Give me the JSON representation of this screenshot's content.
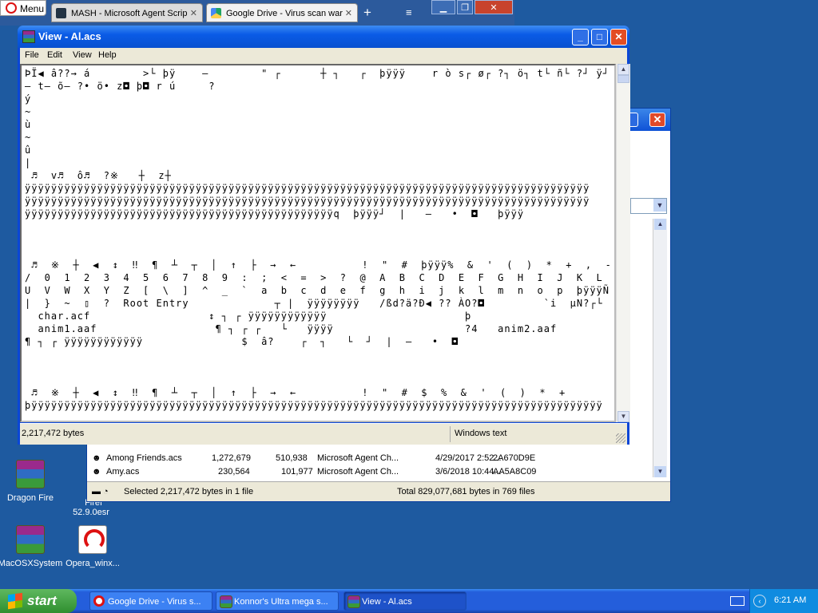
{
  "browser": {
    "menu_label": "Menu",
    "tabs": [
      {
        "title": "MASH - Microsoft Agent Scrip",
        "icon": "mash-favicon"
      },
      {
        "title": "Google Drive - Virus scan war",
        "icon": "google-drive-favicon"
      }
    ],
    "new_tab_glyph": "+",
    "menu_glyph": "≡"
  },
  "explorer": {
    "rows": [
      {
        "name": "Among Friends.acs",
        "size": "1,272,679",
        "packed": "510,938",
        "type": "Microsoft Agent Ch...",
        "modified": "4/29/2017 2:52...",
        "crc": "2A670D9E"
      },
      {
        "name": "Amy.acs",
        "size": "230,564",
        "packed": "101,977",
        "type": "Microsoft Agent Ch...",
        "modified": "3/6/2018 10:44...",
        "crc": "AA5A8C09"
      }
    ],
    "status_left": "Selected 2,217,472 bytes in 1 file",
    "status_right": "Total 829,077,681 bytes in 769 files"
  },
  "view": {
    "title": "View - Al.acs",
    "menu": [
      "File",
      "Edit",
      "View",
      "Help"
    ],
    "content": "ÞÏ◀ â??→ á        >└ þÿ    –        \" ┌      ┼ ┐   ┌  þÿÿÿ    r ò s┌ ø┌ ?┐ ö┐ t└ ñ└ ?┘ ÿ┘ y│\n– t– õ– ?• ö• z◘ þ◘ r ú     ?\ný\n~\nù\n~\nû\n|\n ♬  v♬  ô♬  ?※   ┼  z┼\nÿÿÿÿÿÿÿÿÿÿÿÿÿÿÿÿÿÿÿÿÿÿÿÿÿÿÿÿÿÿÿÿÿÿÿÿÿÿÿÿÿÿÿÿÿÿÿÿÿÿÿÿÿÿÿÿÿÿÿÿÿÿÿÿÿÿÿÿÿÿÿÿÿÿÿÿÿÿÿÿÿÿÿÿÿÿ\nÿÿÿÿÿÿÿÿÿÿÿÿÿÿÿÿÿÿÿÿÿÿÿÿÿÿÿÿÿÿÿÿÿÿÿÿÿÿÿÿÿÿÿÿÿÿÿÿÿÿÿÿÿÿÿÿÿÿÿÿÿÿÿÿÿÿÿÿÿÿÿÿÿÿÿÿÿÿÿÿÿÿÿÿÿÿ\nÿÿÿÿÿÿÿÿÿÿÿÿÿÿÿÿÿÿÿÿÿÿÿÿÿÿÿÿÿÿÿÿÿÿÿÿÿÿÿÿÿÿÿÿÿÿÿq  þÿÿÿ┘  |   –   •  ◘   þÿÿÿ\n\n\n\n ♬  ※  ┼  ◀  ↕  ‼  ¶  ┴  ┬  │  ↑  ├  →  ←          !  \"  #  þÿÿÿ%  &  '  (  )  *  +  ,  -  .\n/  0  1  2  3  4  5  6  7  8  9  :  ;  <  =  >  ?  @  A  B  C  D  E  F  G  H  I  J  K  L  M  N  O  P  Q  R  S  T\nU  V  W  X  Y  Z  [  \\  ]  ^  _  `  a  b  c  d  e  f  g  h  i  j  k  l  m  n  o  p  þÿÿÿÑ  ÿÿÿÿt  u  v  w  x  y  z  {\n|  }  ~  ▯  ?  Root Entry             ┬ |  ÿÿÿÿÿÿÿÿ   /ßd?ä?Ð◀ ?? ÀO?◘         `i  µN?┌└\n  char.acf                  ↕ ┐ ┌ ÿÿÿÿÿÿÿÿÿÿÿÿ                     þ\n  anim1.aaf                  ¶ ┐ ┌ ┌   └   ÿÿÿÿ                    ?4   anim2.aaf\n¶ ┐ ┌ ÿÿÿÿÿÿÿÿÿÿÿÿ               $  â?    ┌  ┐   └  ┘  |  –   •  ◘\n\n\n\n ♬  ※  ┼  ◀  ↕  ‼  ¶  ┴  ┬  │  ↑  ├  →  ←          !  \"  #  $  %  &  '  (  )  *  +\nþÿÿÿÿÿÿÿÿÿÿÿÿÿÿÿÿÿÿÿÿÿÿÿÿÿÿÿÿÿÿÿÿÿÿÿÿÿÿÿÿÿÿÿÿÿÿÿÿÿÿÿÿÿÿÿÿÿÿÿÿÿÿÿÿÿÿÿÿÿÿÿÿÿÿÿÿÿÿÿÿÿÿÿÿÿÿÿ",
    "status_size": "2,217,472 bytes",
    "status_encoding": "Windows text"
  },
  "desktop": {
    "icons": [
      {
        "label": "Dragon Fire",
        "icon": "winrar-icon"
      },
      {
        "label": "Firef\n52.9.0esr",
        "icon": "firefox-icon"
      },
      {
        "label": "MacOSXSystem",
        "icon": "winrar-icon"
      },
      {
        "label": "Opera_winx...",
        "icon": "opera-installer-icon"
      }
    ]
  },
  "taskbar": {
    "start_label": "start",
    "tasks": [
      {
        "label": "Google Drive - Virus s...",
        "icon": "opera-icon"
      },
      {
        "label": "Konnor's Ultra mega s...",
        "icon": "winrar-icon"
      },
      {
        "label": "View - Al.acs",
        "icon": "winrar-icon"
      }
    ],
    "clock": "6:21 AM"
  },
  "colors": {
    "desktop": "#1e5aa0",
    "titlebar": "#0a5be6",
    "close": "#e34d24"
  }
}
